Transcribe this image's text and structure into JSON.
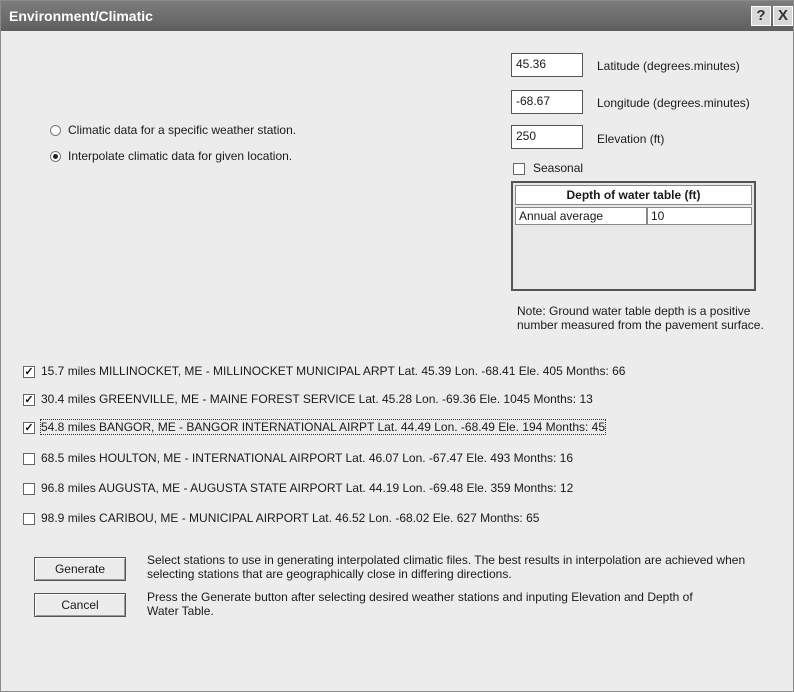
{
  "window": {
    "title": "Environment/Climatic",
    "help_label": "?",
    "close_label": "X"
  },
  "location": {
    "latitude": {
      "value": "45.36",
      "label": "Latitude (degrees.minutes)"
    },
    "longitude": {
      "value": "-68.67",
      "label": "Longitude (degrees.minutes)"
    },
    "elevation": {
      "value": "250",
      "label": "Elevation (ft)"
    }
  },
  "options": {
    "specific_station": "Climatic data for a specific weather station.",
    "interpolate": "Interpolate climatic data  for given location."
  },
  "seasonal_label": "Seasonal",
  "water_table": {
    "header": "Depth of water table (ft)",
    "row_label": "Annual average",
    "row_value": "10"
  },
  "note": "Note: Ground water table depth is a positive number measured from the pavement surface.",
  "stations": [
    {
      "checked": true,
      "text": "15.7 miles MILLINOCKET, ME - MILLINOCKET MUNICIPAL ARPT  Lat. 45.39  Lon. -68.41  Ele. 405  Months: 66"
    },
    {
      "checked": true,
      "text": "30.4 miles GREENVILLE, ME - MAINE FOREST SERVICE  Lat. 45.28  Lon. -69.36  Ele. 1045  Months: 13"
    },
    {
      "checked": true,
      "text": "54.8 miles BANGOR, ME - BANGOR INTERNATIONAL AIRPT  Lat. 44.49  Lon. -68.49  Ele. 194  Months: 45"
    },
    {
      "checked": false,
      "text": "68.5 miles HOULTON, ME - INTERNATIONAL AIRPORT  Lat. 46.07  Lon. -67.47  Ele. 493  Months: 16"
    },
    {
      "checked": false,
      "text": "96.8 miles AUGUSTA, ME - AUGUSTA STATE AIRPORT  Lat. 44.19  Lon. -69.48  Ele. 359  Months: 12"
    },
    {
      "checked": false,
      "text": "98.9 miles CARIBOU, ME - MUNICIPAL AIRPORT  Lat. 46.52  Lon. -68.02  Ele. 627  Months: 65"
    }
  ],
  "buttons": {
    "generate": "Generate",
    "cancel": "Cancel"
  },
  "info": {
    "generate_help": "Select stations to use in generating interpolated climatic files.   The best results in interpolation are achieved when selecting stations that are geographically close in differing directions.",
    "cancel_help": "Press the Generate button after selecting desired weather stations and inputing Elevation and Depth of Water Table."
  }
}
